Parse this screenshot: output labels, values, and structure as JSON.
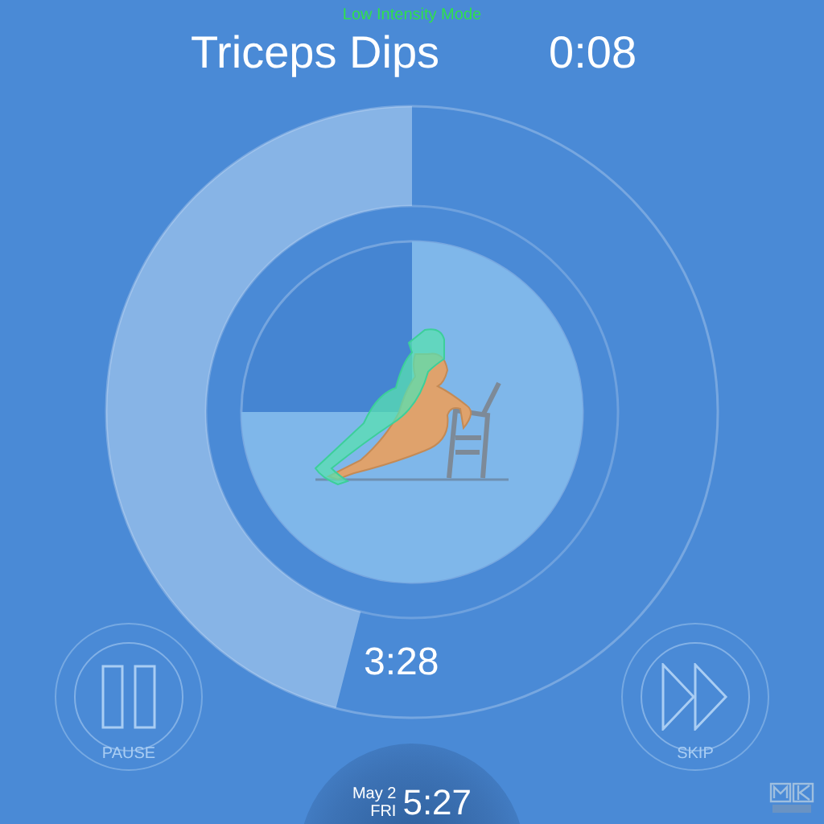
{
  "mode": "Low Intensity Mode",
  "exercise": {
    "name": "Triceps Dips",
    "time": "0:08"
  },
  "workout": {
    "remaining": "3:28"
  },
  "controls": [
    {
      "kind": "pause",
      "label": "PAUSE"
    },
    {
      "kind": "skip",
      "label": "SKIP"
    }
  ],
  "clock": {
    "date": "May 2",
    "weekday": "FRI",
    "time": "5:27"
  }
}
